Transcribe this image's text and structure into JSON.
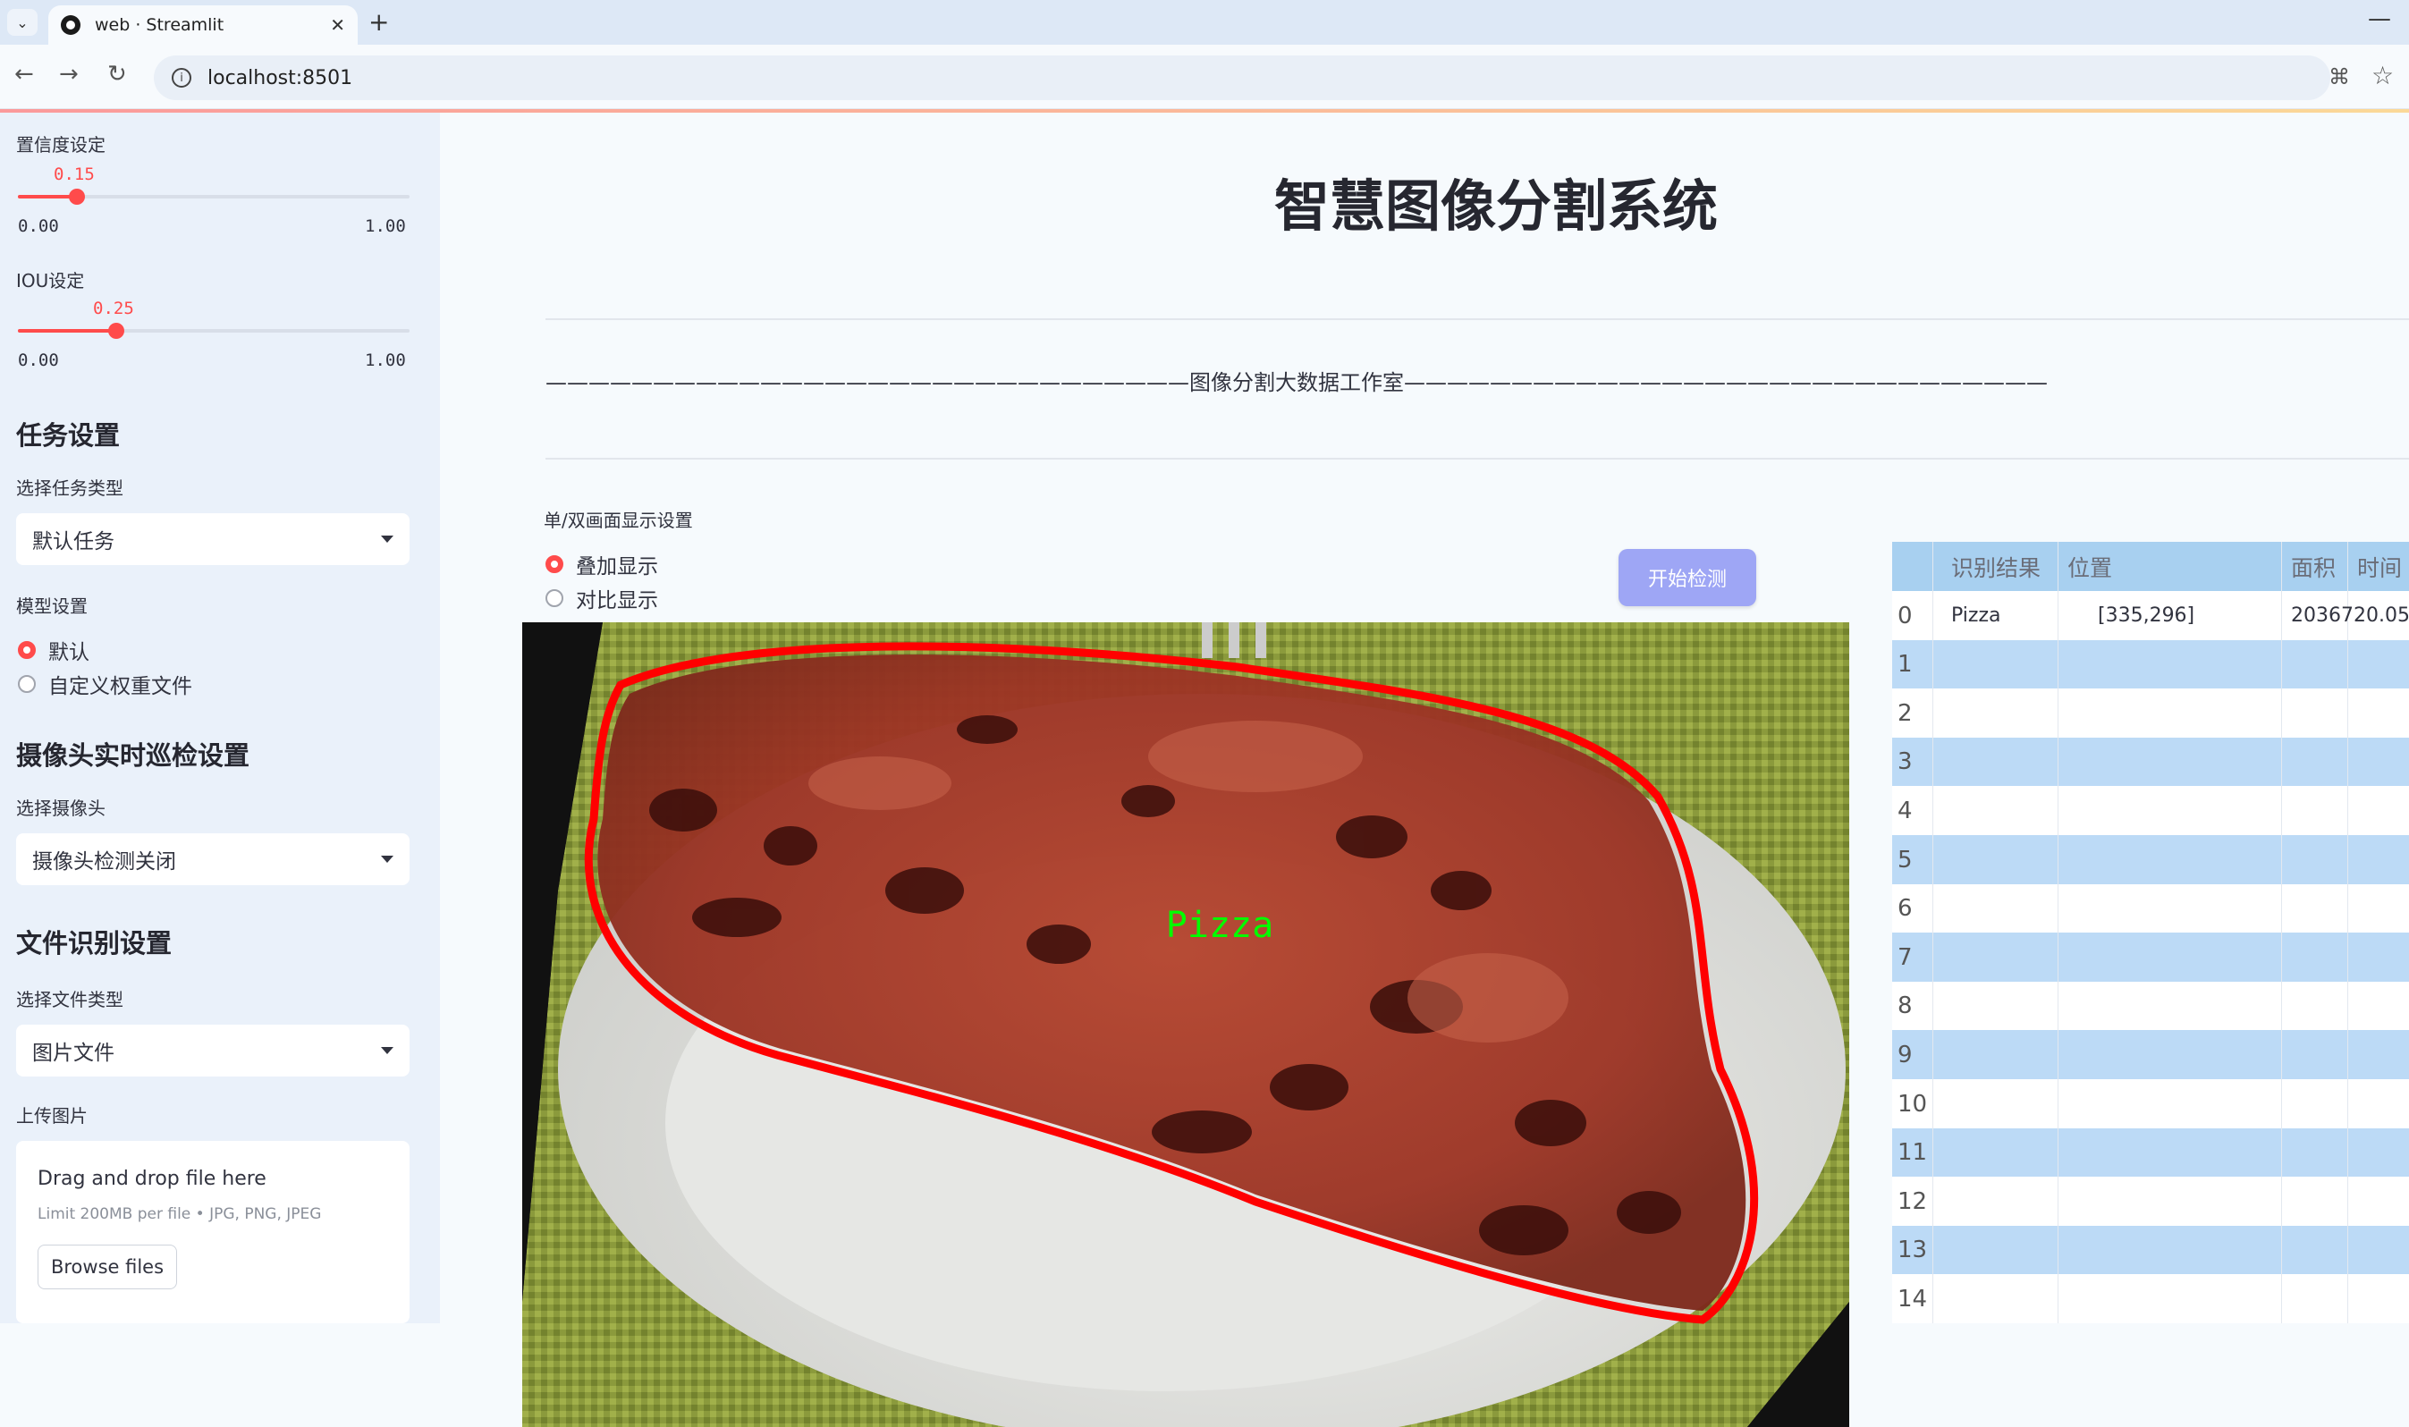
{
  "browser": {
    "tab_title": "web · Streamlit",
    "url": "localhost:8501"
  },
  "sidebar": {
    "confidence": {
      "label": "置信度设定",
      "value": "0.15",
      "min": "0.00",
      "max": "1.00",
      "fraction": 0.15
    },
    "iou": {
      "label": "IOU设定",
      "value": "0.25",
      "min": "0.00",
      "max": "1.00",
      "fraction": 0.25
    },
    "task_section": {
      "heading": "任务设置",
      "select_label": "选择任务类型",
      "select_value": "默认任务"
    },
    "model_section": {
      "label": "模型设置",
      "options": [
        "默认",
        "自定义权重文件"
      ],
      "selected": 0
    },
    "camera_section": {
      "heading": "摄像头实时巡检设置",
      "select_label": "选择摄像头",
      "select_value": "摄像头检测关闭"
    },
    "file_section": {
      "heading": "文件识别设置",
      "select_label": "选择文件类型",
      "select_value": "图片文件"
    },
    "upload": {
      "label": "上传图片",
      "title": "Drag and drop file here",
      "sub": "Limit 200MB per file • JPG, PNG, JPEG",
      "button": "Browse files"
    }
  },
  "main": {
    "title": "智慧图像分割系统",
    "subtitle_line": "——————————————————————————————图像分割大数据工作室——————————————————————————————",
    "display": {
      "label": "单/双画面显示设置",
      "options": [
        "叠加显示",
        "对比显示"
      ],
      "selected": 0
    },
    "detect_button": "开始检测",
    "detection_label": "Pizza"
  },
  "results_table": {
    "headers": [
      "识别结果",
      "位置",
      "面积",
      "时间"
    ],
    "rows": [
      {
        "index": "0",
        "result": "Pizza",
        "position": "[335,296]",
        "area": "2036720.05",
        "time": ""
      },
      {
        "index": "1"
      },
      {
        "index": "2"
      },
      {
        "index": "3"
      },
      {
        "index": "4"
      },
      {
        "index": "5"
      },
      {
        "index": "6"
      },
      {
        "index": "7"
      },
      {
        "index": "8"
      },
      {
        "index": "9"
      },
      {
        "index": "10"
      },
      {
        "index": "11"
      },
      {
        "index": "12"
      },
      {
        "index": "13"
      },
      {
        "index": "14"
      }
    ]
  },
  "colors": {
    "accent": "#ff4b4b",
    "button": "#9ea6f5",
    "table_header": "#a8d0f0",
    "table_stripe": "#bcdaf6",
    "mask_outline": "#ff0000",
    "label_text": "#00ff00"
  }
}
